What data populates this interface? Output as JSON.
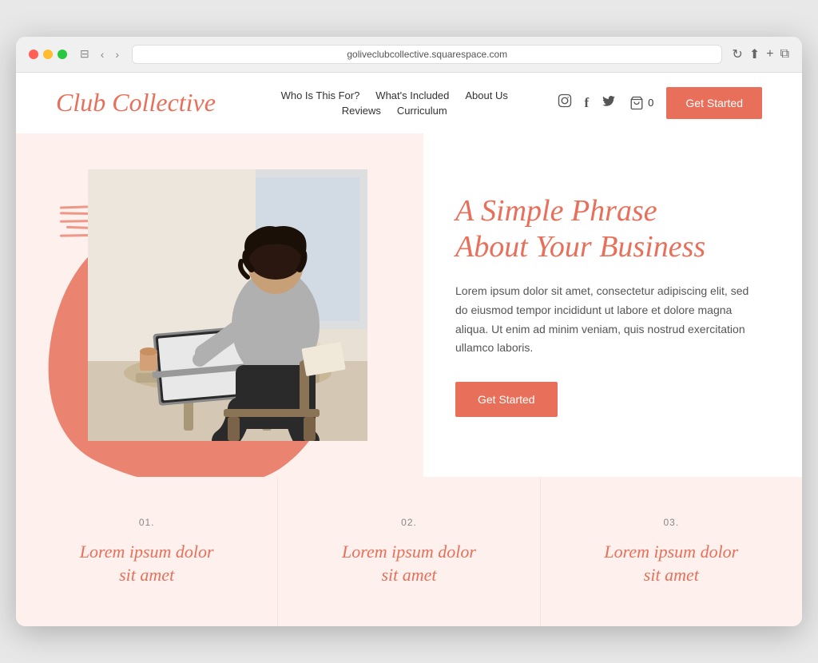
{
  "browser": {
    "url": "goliveclubcollective.squarespace.com",
    "reload_label": "↻"
  },
  "header": {
    "logo": "Club Collective",
    "nav": {
      "row1": [
        {
          "label": "Who Is This For?"
        },
        {
          "label": "What's Included"
        },
        {
          "label": "About Us"
        }
      ],
      "row2": [
        {
          "label": "Reviews"
        },
        {
          "label": "Curriculum"
        }
      ]
    },
    "social": {
      "instagram": "📷",
      "facebook": "f",
      "twitter": "🐦"
    },
    "cart": "0",
    "cta": "Get Started"
  },
  "hero": {
    "title_line1": "A Simple Phrase",
    "title_line2": "About Your Business",
    "description": "Lorem ipsum dolor sit amet, consectetur adipiscing elit, sed do eiusmod tempor incididunt ut labore et dolore magna aliqua. Ut enim ad minim veniam, quis nostrud exercitation ullamco laboris.",
    "cta": "Get Started"
  },
  "features": [
    {
      "number": "01.",
      "title_line1": "Lorem ipsum dolor",
      "title_line2": "sit amet"
    },
    {
      "number": "02.",
      "title_line1": "Lorem ipsum dolor",
      "title_line2": "sit amet"
    },
    {
      "number": "03.",
      "title_line1": "Lorem ipsum dolor",
      "title_line2": "sit amet"
    }
  ],
  "colors": {
    "coral": "#e8705a",
    "light_bg": "#fdf0ed",
    "white": "#ffffff"
  }
}
